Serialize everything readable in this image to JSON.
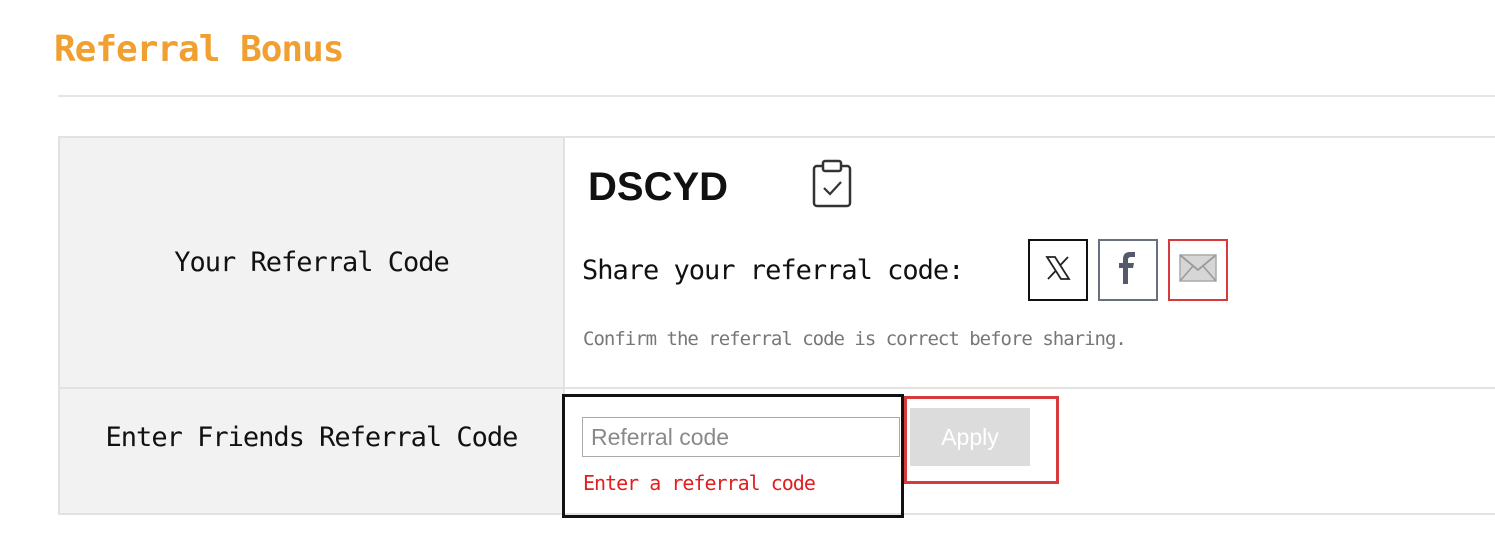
{
  "page": {
    "title": "Referral Bonus"
  },
  "your_code": {
    "label": "Your Referral Code",
    "code": "DSCYD",
    "copy_icon": "clipboard-check-icon",
    "share_label": "Share your referral code:",
    "share_buttons": [
      {
        "icon": "x-icon",
        "glyph": "𝕏"
      },
      {
        "icon": "facebook-icon",
        "glyph": "f"
      },
      {
        "icon": "envelope-icon",
        "glyph": "✉"
      }
    ],
    "hint": "Confirm the referral code is correct before sharing."
  },
  "friend_code": {
    "label": "Enter Friends Referral Code",
    "input_value": "",
    "input_placeholder": "Referral code",
    "error": "Enter a referral code",
    "apply_label": "Apply"
  },
  "colors": {
    "title": "#f0a030",
    "error": "#e02020",
    "highlight_red": "#d63a3a",
    "apply_disabled_bg": "#dcdcdc"
  }
}
